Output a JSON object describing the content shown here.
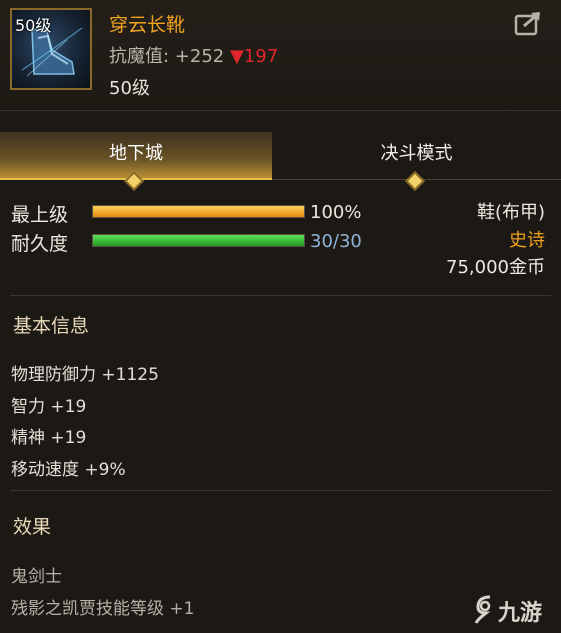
{
  "item": {
    "level_badge": "50级",
    "name": "穿云长靴",
    "resist_label": "抗魔值: +252",
    "resist_diff": "▼197",
    "level_text": "50级"
  },
  "tabs": [
    {
      "label": "地下城",
      "active": true
    },
    {
      "label": "决斗模式",
      "active": false
    }
  ],
  "stats": {
    "level_label": "最上级",
    "level_percent": 100,
    "level_value": "100%",
    "durability_label": "耐久度",
    "durability_current": 30,
    "durability_max": 30,
    "durability_value": "30/30"
  },
  "meta": {
    "type": "鞋(布甲)",
    "rarity": "史诗",
    "price": "75,000金币"
  },
  "basic_info": {
    "title": "基本信息",
    "lines": [
      "物理防御力 +1125",
      "智力 +19",
      "精神 +19",
      "移动速度 +9%"
    ]
  },
  "effects": {
    "title": "效果",
    "class": "鬼剑士",
    "desc": "残影之凯贾技能等级 +1"
  },
  "watermark": "九游",
  "colors": {
    "name": "#f0a21e",
    "diff_down": "#e0262b",
    "rarity": "#f0a21e",
    "durability_text": "#8fb4d8"
  }
}
